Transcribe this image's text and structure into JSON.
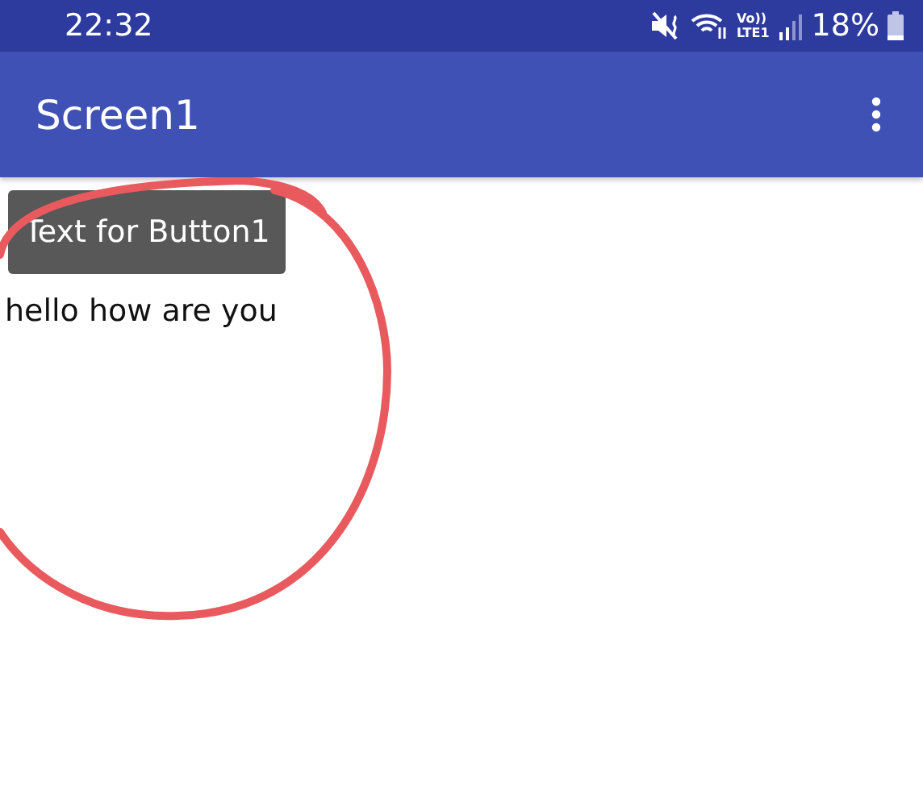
{
  "status_bar": {
    "time": "22:32",
    "volte": "Vo))",
    "network": "LTE1",
    "battery": "18%"
  },
  "app_bar": {
    "title": "Screen1"
  },
  "button": {
    "label": "Text for Button1"
  },
  "label": {
    "text": "hello how are you"
  }
}
